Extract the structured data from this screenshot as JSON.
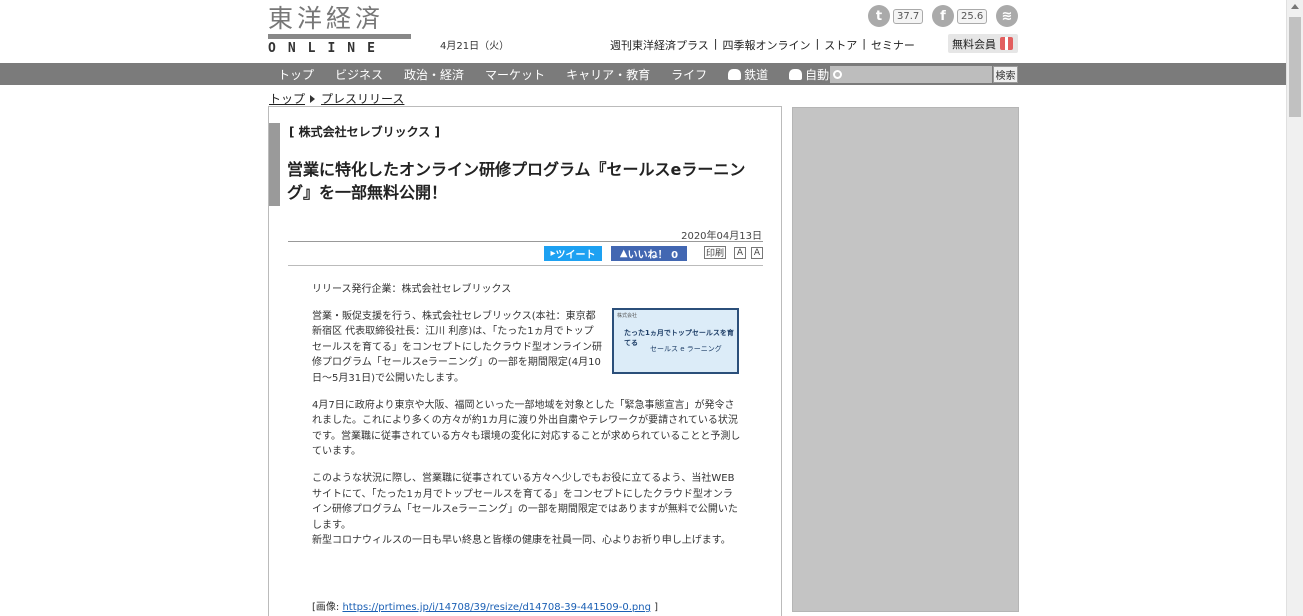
{
  "header": {
    "logo_main": "東洋経済",
    "logo_sub": "ONLINE",
    "date": "4月21日（火）",
    "social": {
      "twitter_count": "37.7",
      "facebook_count": "25.6"
    },
    "toplinks": [
      "週刊東洋経済プラス",
      "四季報オンライン",
      "ストア",
      "セミナー"
    ],
    "member_label": "無料会員"
  },
  "nav": {
    "items": [
      "トップ",
      "ビジネス",
      "政治・経済",
      "マーケット",
      "キャリア・教育",
      "ライフ",
      "鉄道",
      "自動車"
    ],
    "search_placeholder": "",
    "search_button": "検索"
  },
  "breadcrumb": [
    "トップ",
    "プレスリリース"
  ],
  "article": {
    "company": "[ 株式会社セレブリックス ]",
    "title": "営業に特化したオンライン研修プログラム『セールスeラーニング』を一部無料公開！",
    "date": "2020年04月13日",
    "share": {
      "tweet": "ツイート",
      "like": "いいね！ 0",
      "print": "印刷",
      "font_a1": "A",
      "font_a2": "A"
    },
    "paragraphs": [
      "リリース発行企業：株式会社セレブリックス",
      "営業・販促支援を行う、株式会社セレブリックス(本社：東京都新宿区 代表取締役社長：江川 利彦)は、「たった1ヵ月でトップセールスを育てる」をコンセプトにしたクラウド型オンライン研修プログラム「セールスeラーニング」の一部を期間限定(4月10日～5月31日)で公開いたします。",
      "4月7日に政府より東京や大阪、福岡といった一部地域を対象とした「緊急事態宣言」が発令されました。これにより多くの方々が約1カ月に渡り外出自粛やテレワークが要請されている状況です。営業職に従事されている方々も環境の変化に対応することが求められていることと予測しています。",
      "このような状況に際し、営業職に従事されている方々へ少しでもお役に立てるよう、当社WEBサイトにて、「たった1ヵ月でトップセールスを育てる」をコンセプトにしたクラウド型オンライン研修プログラム「セールスeラーニング」の一部を期間限定ではありますが無料で公開いたします。",
      "新型コロナウィルスの一日も早い終息と皆様の健康を社員一同、心よりお祈り申し上げます。"
    ],
    "thumbnail": {
      "top": "株式会社",
      "title": "たった1ヵ月でトップセールスを育てる",
      "sub": "セールス e ラーニング"
    },
    "image_prefix": "[画像: ",
    "image_url": "https://prtimes.jp/i/14708/39/resize/d14708-39-441509-0.png",
    "image_suffix": " ]"
  }
}
